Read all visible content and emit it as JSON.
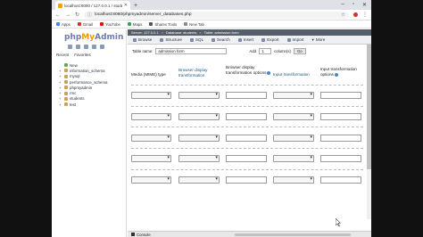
{
  "browser": {
    "tab_title": "localhost:8080 / 127.0.0.1 / stude",
    "url": "localhost:8080/phpmyadmin/server_databases.php",
    "bookmarks": [
      {
        "label": "Apps",
        "color": "#4285f4"
      },
      {
        "label": "Gmail",
        "color": "#d93025"
      },
      {
        "label": "YouTube",
        "color": "#ff0000"
      },
      {
        "label": "Maps",
        "color": "#34a853"
      },
      {
        "label": "Shares Tools",
        "color": "#555555"
      },
      {
        "label": "New Tab",
        "color": "#888888"
      }
    ]
  },
  "sidebar": {
    "logo": {
      "php": "php",
      "my": "My",
      "admin": "Admin"
    },
    "tabs": [
      "Recent",
      "Favorites"
    ],
    "databases": [
      "New",
      "information_schema",
      "mysql",
      "performance_schema",
      "phpmyadmin",
      "rmc",
      "students",
      "test"
    ]
  },
  "breadcrumb": {
    "server": "Server: 127.0.0.1",
    "database": "Database: students",
    "table": "Table: admission form"
  },
  "topnav": [
    "Browse",
    "Structure",
    "SQL",
    "Search",
    "Insert",
    "Export",
    "Import",
    "More"
  ],
  "form": {
    "table_name_label": "Table name:",
    "table_name_value": "admission form",
    "add_label": "Add",
    "add_value": "1",
    "columns_label": "column(s)",
    "go_label": "Go"
  },
  "columns": {
    "mime": "Media (MIME) type",
    "browser_transform": "Browser display transformation",
    "browser_transform_opts": "Browser display transformation options",
    "input_transform": "Input transformation",
    "input_transform_opts": "Input transformation options"
  },
  "row_count": 5,
  "console_label": "Console"
}
